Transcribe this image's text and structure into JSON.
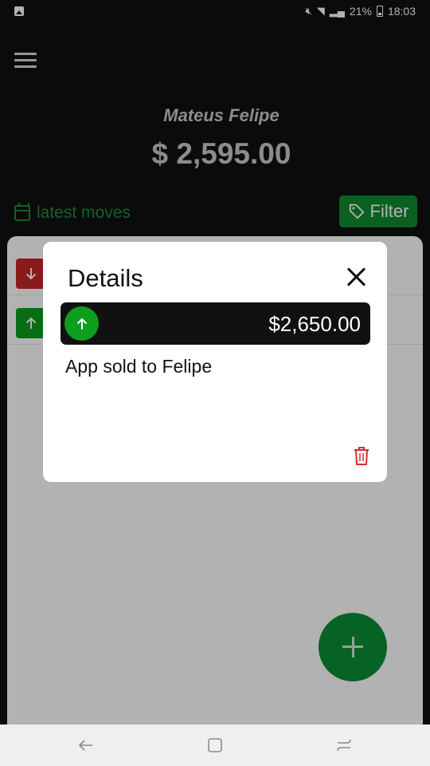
{
  "status_bar": {
    "battery": "21%",
    "time": "18:03"
  },
  "header": {
    "user_name": "Mateus Felipe",
    "balance": "$ 2,595.00"
  },
  "moves": {
    "label": "latest moves",
    "filter_label": "Filter"
  },
  "list": {
    "rows": [
      {
        "direction": "out"
      },
      {
        "direction": "in"
      }
    ]
  },
  "modal": {
    "title": "Details",
    "amount": "$2,650.00",
    "direction": "in",
    "description": "App sold to Felipe"
  },
  "icons": {
    "menu": "menu-icon",
    "calendar": "calendar-icon",
    "tag": "tag-icon",
    "close": "close-icon",
    "arrow_up": "arrow-up-icon",
    "arrow_down": "arrow-down-icon",
    "trash": "trash-icon",
    "add": "plus-icon"
  },
  "colors": {
    "background": "#111111",
    "accent_green": "#0e8a30",
    "income_green": "#0f9d1f",
    "expense_red": "#c62828",
    "delete_red": "#d32f2f"
  }
}
